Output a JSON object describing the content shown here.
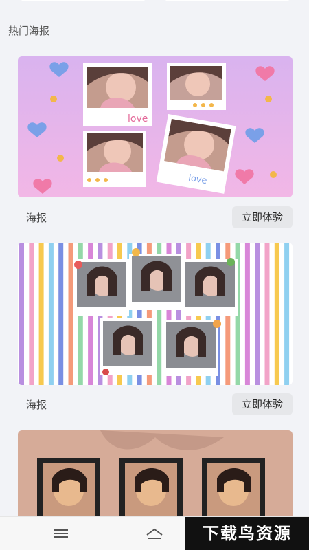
{
  "section": {
    "title": "热门海报"
  },
  "posters": [
    {
      "label": "海报",
      "button": "立即体验",
      "caption_1": "love",
      "caption_2": "love"
    },
    {
      "label": "海报",
      "button": "立即体验"
    },
    {}
  ],
  "watermark": "下载鸟资源",
  "colors": {
    "pink_bg": "#e8b5ee",
    "frame_bg": "#d7ad9a"
  },
  "icons": {
    "menu": "menu-icon",
    "home": "home-icon"
  }
}
